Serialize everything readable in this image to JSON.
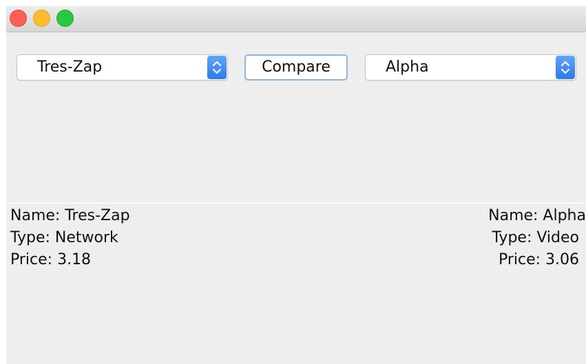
{
  "window": {
    "buttons": [
      "close",
      "minimize",
      "zoom"
    ],
    "colors": {
      "close": "#fd5f57",
      "minimize": "#febc2e",
      "zoom": "#28c840"
    }
  },
  "toolbar": {
    "left_select": {
      "selected": "Tres-Zap",
      "icon": "updown-chevron-icon"
    },
    "compare_label": "Compare",
    "right_select": {
      "selected": "Alpha",
      "icon": "updown-chevron-icon"
    },
    "accent_color": "#2e78ea"
  },
  "left_details": {
    "name": "Name: Tres-Zap",
    "type": "Type: Network",
    "price": "Price: 3.18"
  },
  "right_details": {
    "name": "Name: Alpha",
    "type": "Type: Video",
    "price": "Price: 3.06"
  }
}
